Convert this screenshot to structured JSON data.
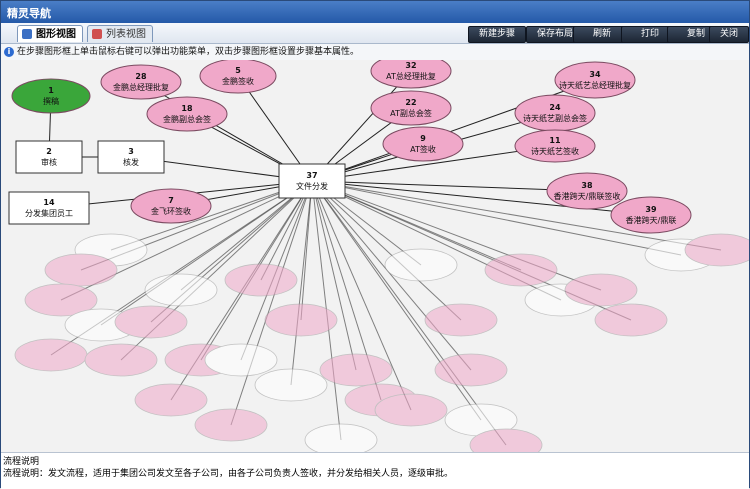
{
  "window": {
    "title": "精灵导航"
  },
  "tabs": [
    {
      "label": "图形视图",
      "active": true
    },
    {
      "label": "列表视图",
      "active": false
    }
  ],
  "toolbar_buttons": [
    "新建步骤",
    "保存布局",
    "刷新",
    "打印",
    "复制",
    "关闭"
  ],
  "hint": "在步骤图形框上单击鼠标右键可以弹出功能菜单，双击步骤图形框设置步骤基本属性。",
  "colors": {
    "pink": "#f0a8c9",
    "green": "#3aa63a",
    "box": "#ffffff",
    "edge": "#222222"
  },
  "nodes": [
    {
      "id": "1",
      "label": "撰稿",
      "shape": "start"
    },
    {
      "id": "2",
      "label": "审核",
      "shape": "box"
    },
    {
      "id": "3",
      "label": "核发",
      "shape": "box"
    },
    {
      "id": "37",
      "label": "文件分发",
      "shape": "box"
    },
    {
      "id": "14",
      "label": "分发集团员工",
      "shape": "box"
    },
    {
      "id": "28",
      "label": "金鹏总经理批复",
      "shape": "ellipse"
    },
    {
      "id": "5",
      "label": "金鹏签收",
      "shape": "ellipse"
    },
    {
      "id": "18",
      "label": "金鹏副总会签",
      "shape": "ellipse"
    },
    {
      "id": "7",
      "label": "金飞环签收",
      "shape": "ellipse"
    },
    {
      "id": "32",
      "label": "AT总经理批复",
      "shape": "ellipse"
    },
    {
      "id": "22",
      "label": "AT副总会签",
      "shape": "ellipse"
    },
    {
      "id": "9",
      "label": "AT签收",
      "shape": "ellipse"
    },
    {
      "id": "34",
      "label": "诗天纸艺总经理批复",
      "shape": "ellipse"
    },
    {
      "id": "24",
      "label": "诗天纸艺副总会签",
      "shape": "ellipse"
    },
    {
      "id": "11",
      "label": "诗天纸艺签收",
      "shape": "ellipse"
    },
    {
      "id": "38",
      "label": "香港跨天/鼎联签收",
      "shape": "ellipse"
    },
    {
      "id": "39",
      "label": "香港跨天/鼎联",
      "shape": "ellipse"
    }
  ],
  "status": {
    "line1": "流程说明",
    "line2": "流程说明：发文流程，适用于集团公司发文至各子公司，由各子公司负责人签收，并分发给相关人员，逐级审批。"
  }
}
